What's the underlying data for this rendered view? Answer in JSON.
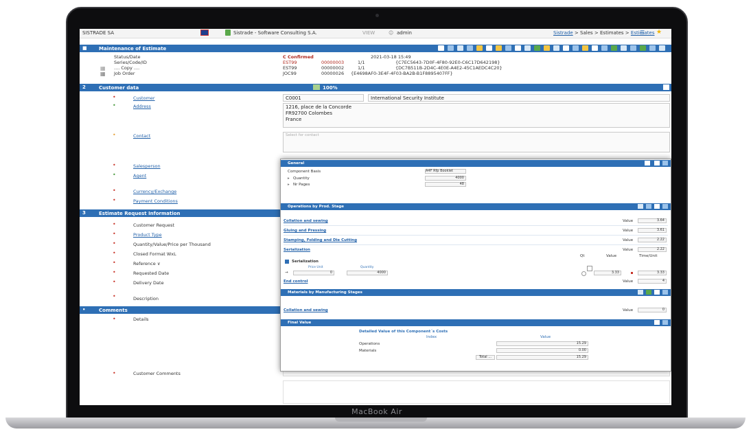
{
  "device_label": "MacBook Air",
  "topbar": {
    "company": "SISTRADE SA",
    "app_title": "Sistrade - Software Consulting S.A.",
    "mode": "VIEW",
    "user": "admin",
    "breadcrumb": [
      "Sistrade",
      "Sales",
      "Estimates",
      "Estimates"
    ]
  },
  "maintenance": {
    "header": "Maintenance of Estimate",
    "labels": [
      "Status/Date",
      "Series/Code/ID",
      ".... Copy ....",
      "Job Order"
    ],
    "status": "C  Confirmed",
    "date": "2021-03-18 15:49",
    "series": "EST99",
    "code": "00000003",
    "rev": "1/1",
    "id": "{C7EC5643-7D0F-4F80-92E0-C6C17D642198}",
    "copy_series": "EST99",
    "copy_code": "00000002",
    "copy_rev": "1/1",
    "copy_id": "{DC7B511B-2D4C-4E0E-A4E2-45C1AEDC4C20}",
    "job_series": "JOC99",
    "job_code": "00000026",
    "job_id": "{E4698AF0-3E4F-4F03-BA2B-B1F8895407FF}"
  },
  "customer": {
    "header": "Customer data",
    "progress": "100%",
    "customer_label": "Customer",
    "customer_code": "C0001",
    "customer_name": "International Security Institute",
    "address_label": "Address",
    "address_lines": [
      "1216, place de la Concorde",
      "FR92700 Colombes",
      "France"
    ],
    "contact_label": "Contact",
    "contact_placeholder": "Select for contact",
    "salesperson_label": "Salesperson",
    "agent_label": "Agent",
    "currency_label": "Currency/Exchange",
    "payment_label": "Payment Conditions"
  },
  "estimate_info": {
    "header": "Estimate Request Information",
    "rows": [
      "Customer Request",
      "Product Type",
      "Quantity/Value/Price per Thousand",
      "Closed Format WxL",
      "Reference",
      "Requested Date",
      "Delivery Date",
      "Description"
    ]
  },
  "comments": {
    "header": "Comments",
    "details_label": "Details",
    "customer_comments_label": "Customer Comments"
  },
  "dialog": {
    "general": {
      "header": "General",
      "component_basis_label": "Component Basis",
      "component_basis_value": "A4F Rfp Booklet",
      "quantity_label": "Quantity",
      "quantity_value": "4000",
      "pages_label": "Nr Pages",
      "pages_value": "48"
    },
    "operations": {
      "header": "Operations by Prod. Stage",
      "value_label": "Value",
      "items": [
        {
          "label": "Collation and sewing",
          "value": "3.64"
        },
        {
          "label": "Gluing and Pressing",
          "value": "3.61"
        },
        {
          "label": "Stamping, Folding and Die Cutting",
          "value": "2.22"
        },
        {
          "label": "Serialization",
          "value": "2.22"
        }
      ],
      "col_qt": "Qt",
      "col_value": "Value",
      "col_time": "Time/Unit",
      "serialization_sub": "Serialization",
      "price_unit_label": "Price Unit",
      "quantity_label": "Quantity",
      "price_unit_value": "0",
      "quantity_value": "4000",
      "line_value": "3.33",
      "line_total": "3.33",
      "end_control": "End control",
      "end_control_value": "4"
    },
    "materials": {
      "header": "Materials by Manufacturing Stages",
      "item": "Collation and sewing",
      "value": "0"
    },
    "final": {
      "header": "Final Value",
      "title": "Detailed Value of this Component´s Costs",
      "col_index": "Index",
      "col_value": "Value",
      "rows": [
        {
          "label": "Operations",
          "value": "15.29"
        },
        {
          "label": "Materials",
          "value": "0.00"
        }
      ],
      "total_label": "Total ...",
      "total_value": "15.29"
    }
  }
}
